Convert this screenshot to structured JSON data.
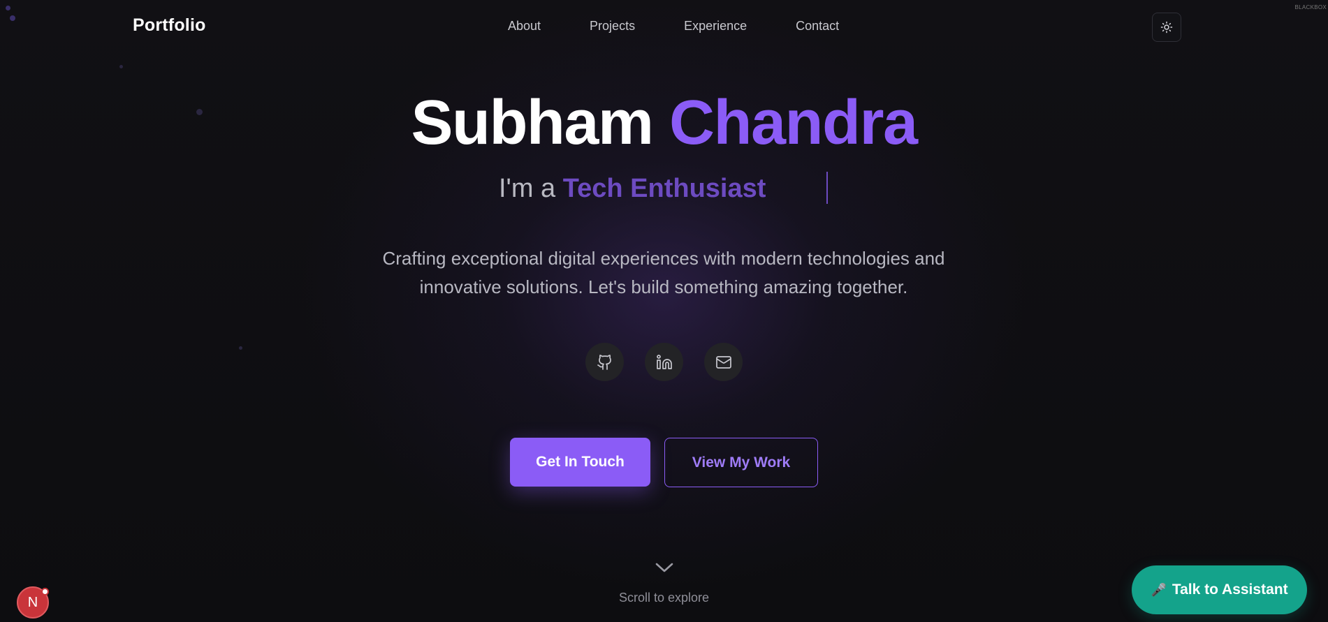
{
  "nav": {
    "logo": "Portfolio",
    "links": [
      {
        "label": "About"
      },
      {
        "label": "Projects"
      },
      {
        "label": "Experience"
      },
      {
        "label": "Contact"
      }
    ],
    "theme_toggle_icon": "sun-icon",
    "corner_badge": "BLACKBOX"
  },
  "hero": {
    "first_name": "Subham",
    "last_name": "Chandra",
    "tagline_prefix": "I'm a",
    "tagline_role": "Tech Enthusiast",
    "description_line1": "Crafting exceptional digital experiences with modern technologies and",
    "description_line2": "innovative solutions. Let's build something amazing together."
  },
  "socials": [
    {
      "icon": "github-icon"
    },
    {
      "icon": "linkedin-icon"
    },
    {
      "icon": "mail-icon"
    }
  ],
  "cta": {
    "primary_label": "Get In Touch",
    "secondary_label": "View My Work"
  },
  "scroll": {
    "icon": "chevron-down-icon",
    "label": "Scroll to explore"
  },
  "assistant": {
    "icon": "microphone-icon",
    "label": "Talk to Assistant"
  },
  "dev_badge": {
    "letter": "N"
  },
  "colors": {
    "accent": "#8b5cf6",
    "role_text": "#6d4bc1",
    "assistant": "#14a38b",
    "background": "#0d0d10"
  }
}
